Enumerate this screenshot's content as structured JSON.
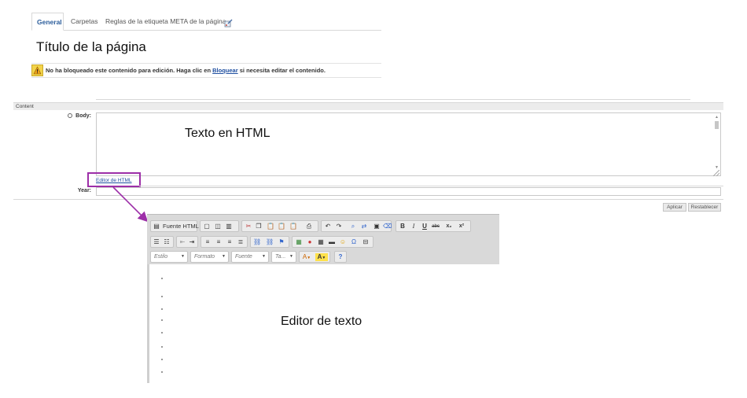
{
  "tabs": {
    "items": [
      {
        "label": "General",
        "active": true
      },
      {
        "label": "Carpetas",
        "active": false
      },
      {
        "label": "Reglas de la etiqueta META de la página",
        "active": false
      }
    ],
    "extra_icon": "edit-properties-icon"
  },
  "page_title": "Título de la página",
  "warning": {
    "icon": "warning-icon",
    "text_before": "No ha bloqueado este contenido para edición. Haga clic en",
    "link": "Bloquear",
    "text_after": "si necesita editar el contenido."
  },
  "content_section": {
    "header": "Content",
    "body_label": "Body:",
    "body_annotation": "Texto en HTML",
    "editor_link": "Editor de HTML",
    "year_label": "Year:",
    "year_value": ""
  },
  "buttons": {
    "apply": "Aplicar",
    "reset": "Restablecer"
  },
  "editor": {
    "source_label": "Fuente HTML",
    "combos": [
      "Estilo",
      "Formato",
      "Fuente",
      "Ta..."
    ],
    "annotation": "Editor de texto",
    "colors": {
      "accent": "#9d2fa8",
      "link": "#1f4fa0"
    }
  }
}
